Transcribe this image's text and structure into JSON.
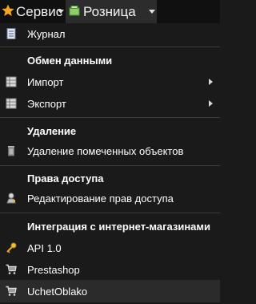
{
  "menubar": {
    "service_label": "Сервис",
    "retail_label": "Розница",
    "service_icon": "star-icon",
    "star_color": "#f5a623"
  },
  "menu": {
    "journal": "Журнал",
    "heading_exchange": "Обмен данными",
    "import": "Импорт",
    "export": "Экспорт",
    "heading_deletion": "Удаление",
    "delete_marked": "Удаление помеченных объектов",
    "heading_access": "Права доступа",
    "edit_access": "Редактирование прав доступа",
    "heading_integration": "Интеграция с интернет-магазинами",
    "api": "API 1.0",
    "prestashop": "Prestashop",
    "ucheto": "UchetOblako"
  }
}
